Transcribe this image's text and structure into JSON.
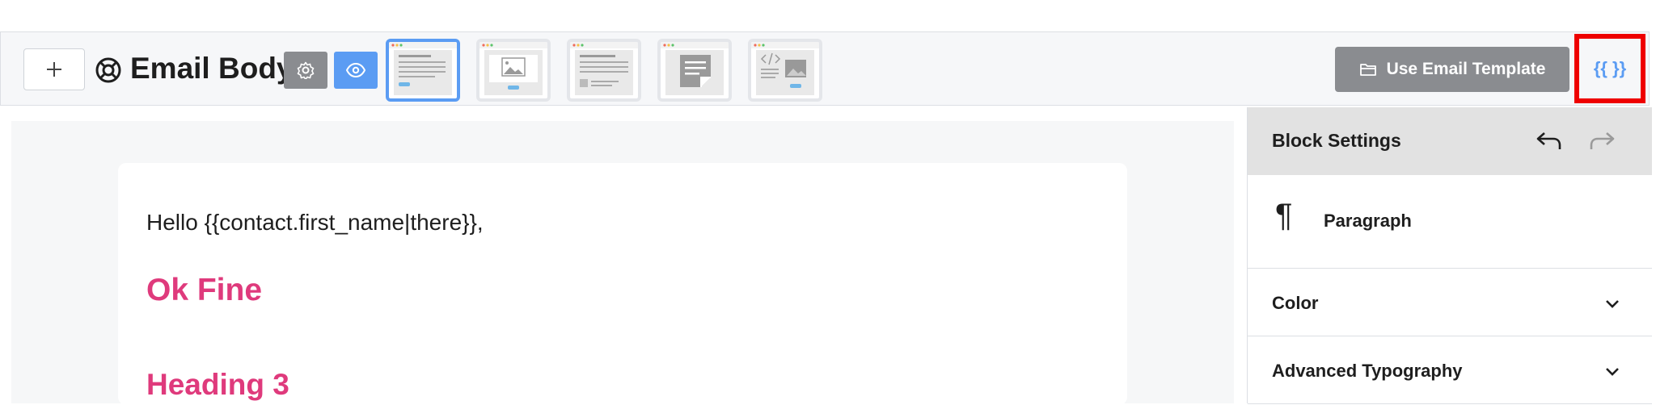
{
  "toolbar": {
    "add_icon": "plus-icon",
    "title_icon": "lifebuoy-icon",
    "title": "Email Body",
    "settings_icon": "gear-icon",
    "preview_icon": "eye-icon",
    "templates": [
      {
        "name": "template-text",
        "active": true
      },
      {
        "name": "template-image"
      },
      {
        "name": "template-text-image"
      },
      {
        "name": "template-note"
      },
      {
        "name": "template-code"
      }
    ],
    "use_template_label": "Use Email Template",
    "use_template_icon": "folder-icon",
    "code_label": "{{ }}"
  },
  "email": {
    "greeting": "Hello {{contact.first_name|there}},",
    "heading2": "Ok Fine",
    "heading3": "Heading 3"
  },
  "sidebar": {
    "title": "Block Settings",
    "undo_icon": "undo-icon",
    "redo_icon": "redo-icon",
    "block_icon": "¶",
    "block_name": "Paragraph",
    "panels": [
      {
        "label": "Color"
      },
      {
        "label": "Advanced Typography"
      }
    ]
  },
  "colors": {
    "accent": "#5b9cf3",
    "heading": "#df3a7c",
    "highlight": "#ee0000",
    "muted_button": "#8a8c90"
  }
}
